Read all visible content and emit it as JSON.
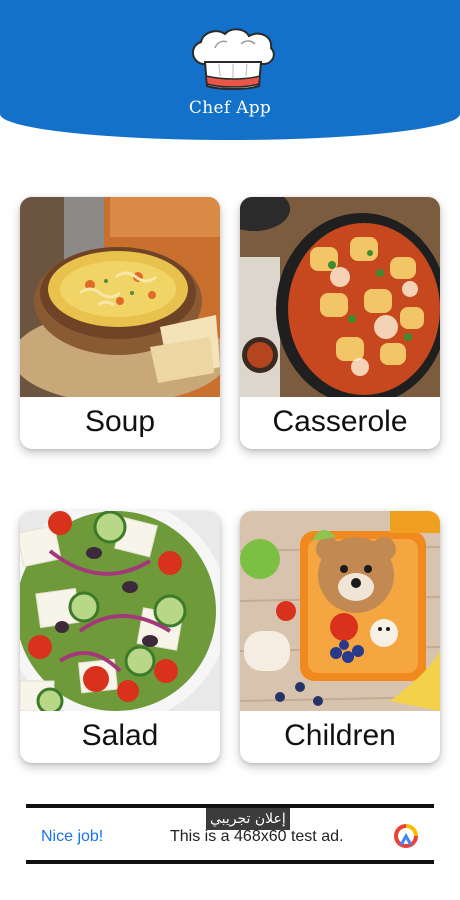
{
  "header": {
    "title": "Chef App",
    "logo_icon": "chef-hat-icon",
    "color": "#1471c9"
  },
  "categories": [
    {
      "label": "Soup",
      "image": "chicken-noodle-soup-photo"
    },
    {
      "label": "Casserole",
      "image": "ravioli-casserole-photo"
    },
    {
      "label": "Salad",
      "image": "greek-salad-photo"
    },
    {
      "label": "Children",
      "image": "kids-bento-lunch-photo"
    }
  ],
  "ad": {
    "tag": "إعلان تجريبي",
    "headline": "Nice job!",
    "text": "This is a 468x60 test ad.",
    "icon": "adchoices-icon"
  }
}
